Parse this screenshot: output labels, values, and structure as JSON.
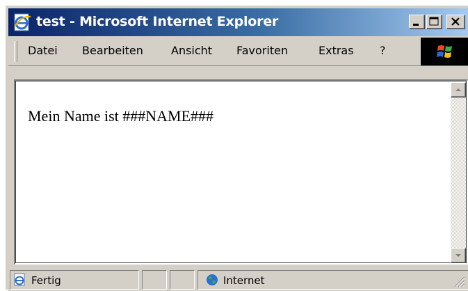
{
  "window": {
    "title": "test - Microsoft Internet Explorer"
  },
  "menubar": {
    "items": [
      {
        "label": "Datei"
      },
      {
        "label": "Bearbeiten"
      },
      {
        "label": "Ansicht"
      },
      {
        "label": "Favoriten"
      },
      {
        "label": "Extras"
      },
      {
        "label": "?"
      }
    ]
  },
  "page": {
    "text": "Mein Name ist ###NAME###"
  },
  "statusbar": {
    "status": "Fertig",
    "zone": "Internet"
  },
  "colors": {
    "title_start": "#0a246a",
    "title_end": "#a6caf0",
    "chrome": "#d4d0c8"
  },
  "icons": [
    "ie-page-icon",
    "minimize-icon",
    "maximize-icon",
    "close-icon",
    "windows-logo-icon",
    "scroll-up-icon",
    "scroll-down-icon",
    "internet-zone-icon",
    "resize-grip-icon"
  ]
}
